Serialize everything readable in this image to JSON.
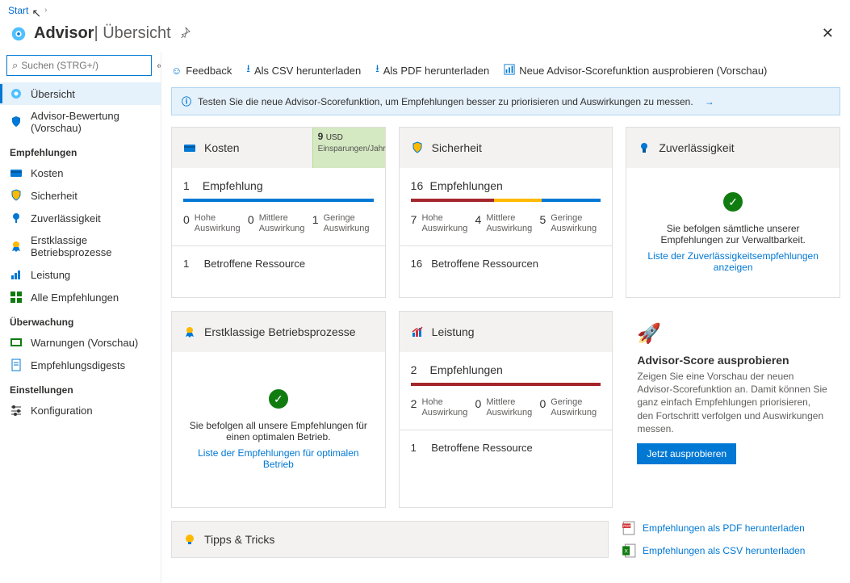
{
  "breadcrumb": {
    "start": "Start"
  },
  "header": {
    "title": "Advisor",
    "subtitle": "Übersicht"
  },
  "search": {
    "placeholder": "Suchen (STRG+/)"
  },
  "nav": {
    "overview": "Übersicht",
    "scoring": "Advisor-Bewertung (Vorschau)",
    "section_rec": "Empfehlungen",
    "cost": "Kosten",
    "security": "Sicherheit",
    "reliability": "Zuverlässigkeit",
    "operational": "Erstklassige Betriebsprozesse",
    "performance": "Leistung",
    "all": "Alle Empfehlungen",
    "section_monitor": "Überwachung",
    "alerts": "Warnungen (Vorschau)",
    "digests": "Empfehlungsdigests",
    "section_settings": "Einstellungen",
    "config": "Konfiguration"
  },
  "toolbar": {
    "feedback": "Feedback",
    "csv": "Als CSV herunterladen",
    "pdf": "Als PDF herunterladen",
    "score": "Neue Advisor-Scorefunktion ausprobieren (Vorschau)"
  },
  "banner": {
    "text": "Testen Sie die neue Advisor-Scorefunktion, um Empfehlungen besser zu priorisieren und Auswirkungen zu messen."
  },
  "impact_labels": {
    "high": "Hohe Auswirkung",
    "med": "Mittlere Auswirkung",
    "low": "Geringe Auswirkung"
  },
  "cards": {
    "cost": {
      "title": "Kosten",
      "savings_amount": "9",
      "savings_unit": "USD",
      "savings_label": "Einsparungen/Jahr",
      "rec_count": "1",
      "rec_label": "Empfehlung",
      "high": "0",
      "med": "0",
      "low": "1",
      "res_count": "1",
      "res_label": "Betroffene Ressource"
    },
    "security": {
      "title": "Sicherheit",
      "rec_count": "16",
      "rec_label": "Empfehlungen",
      "high": "7",
      "med": "4",
      "low": "5",
      "res_count": "16",
      "res_label": "Betroffene Ressourcen"
    },
    "reliability": {
      "title": "Zuverlässigkeit",
      "ok_text": "Sie befolgen sämtliche unserer Empfehlungen zur Verwaltbarkeit.",
      "ok_link": "Liste der Zuverlässigkeitsempfehlungen anzeigen"
    },
    "operational": {
      "title": "Erstklassige Betriebsprozesse",
      "ok_text": "Sie befolgen all unsere Empfehlungen für einen optimalen Betrieb.",
      "ok_link": "Liste der Empfehlungen für optimalen Betrieb"
    },
    "performance": {
      "title": "Leistung",
      "rec_count": "2",
      "rec_label": "Empfehlungen",
      "high": "2",
      "med": "0",
      "low": "0",
      "res_count": "1",
      "res_label": "Betroffene Ressource"
    },
    "promo": {
      "title": "Advisor-Score ausprobieren",
      "text": "Zeigen Sie eine Vorschau der neuen Advisor-Scorefunktion an. Damit können Sie ganz einfach Empfehlungen priorisieren, den Fortschritt verfolgen und Auswirkungen messen.",
      "button": "Jetzt ausprobieren"
    }
  },
  "tips": {
    "title": "Tipps & Tricks"
  },
  "downloads": {
    "pdf": "Empfehlungen als PDF herunterladen",
    "csv": "Empfehlungen als CSV herunterladen"
  }
}
